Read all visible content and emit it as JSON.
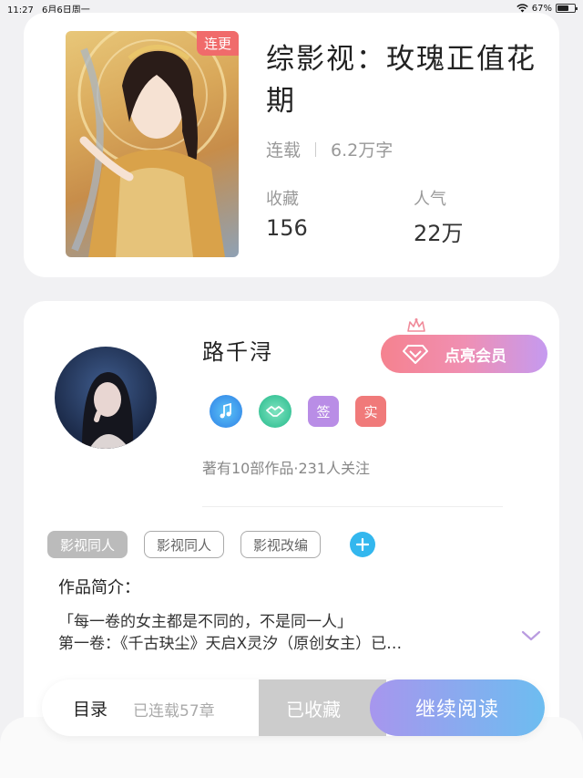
{
  "status_bar": {
    "time": "11:27",
    "date": "6月6日周一",
    "battery": "67%",
    "battery_level": 0.67
  },
  "book": {
    "title": "综影视：玫瑰正值花期",
    "badge": "连更",
    "status": "连载",
    "word_count": "6.2万字",
    "collect_label": "收藏",
    "collect_value": "156",
    "popularity_label": "人气",
    "popularity_value": "22万"
  },
  "author": {
    "name": "路千浔",
    "vip_label": "点亮会员",
    "badges": {
      "sign": "签",
      "real": "实"
    },
    "stats": "著有10部作品·231人关注"
  },
  "tags": [
    "影视同人",
    "影视同人",
    "影视改编"
  ],
  "intro": {
    "title": "作品简介：",
    "line1": "「每一卷的女主都是不同的，不是同一人」",
    "line2": "第一卷：《千古玦尘》天启X灵汐（原创女主）已…"
  },
  "bottom_bar": {
    "toc_label": "目录",
    "chapter_count": "已连载57章",
    "collected_label": "已收藏",
    "read_label": "继续阅读"
  },
  "colors": {
    "accent_red": "#f06b6b",
    "accent_blue": "#33b7ee",
    "read_gradient_start": "#a796ee",
    "read_gradient_end": "#6dbdf0"
  }
}
